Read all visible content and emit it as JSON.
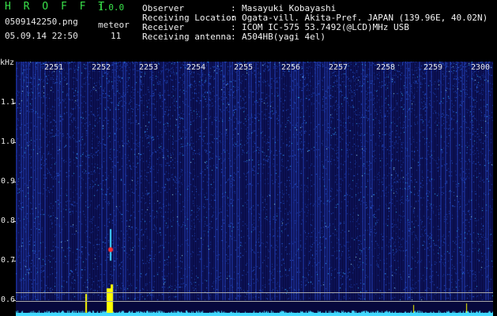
{
  "header": {
    "app_title": "H R O F F T",
    "version": "1.0.0",
    "filename": "0509142250.png",
    "datetime": "05.09.14 22:50",
    "meteor_label": "meteor",
    "meteor_count": "11"
  },
  "info": [
    {
      "label": "Observer",
      "value": "Masayuki Kobayashi"
    },
    {
      "label": "Receiving Location",
      "value": "Ogata-vill. Akita-Pref. JAPAN (139.96E, 40.02N)"
    },
    {
      "label": "Receiver",
      "value": "ICOM IC-575 53.7492(@LCD)MHz USB"
    },
    {
      "label": "Receiving antenna",
      "value": "A504HB(yagi 4el)"
    }
  ],
  "info_separator": ":",
  "spectrogram": {
    "y_unit": "kHz",
    "y_ticks": [
      "1.1",
      "1.0",
      "0.9",
      "0.8",
      "0.7",
      "0.6"
    ],
    "x_ticks": [
      "2251",
      "2252",
      "2253",
      "2254",
      "2255",
      "2256",
      "2257",
      "2258",
      "2259",
      "2300"
    ],
    "colors": {
      "background": "#06083c",
      "signal": "#41d8ff",
      "meteor": "#ff3030",
      "spike": "#ffff00"
    }
  }
}
